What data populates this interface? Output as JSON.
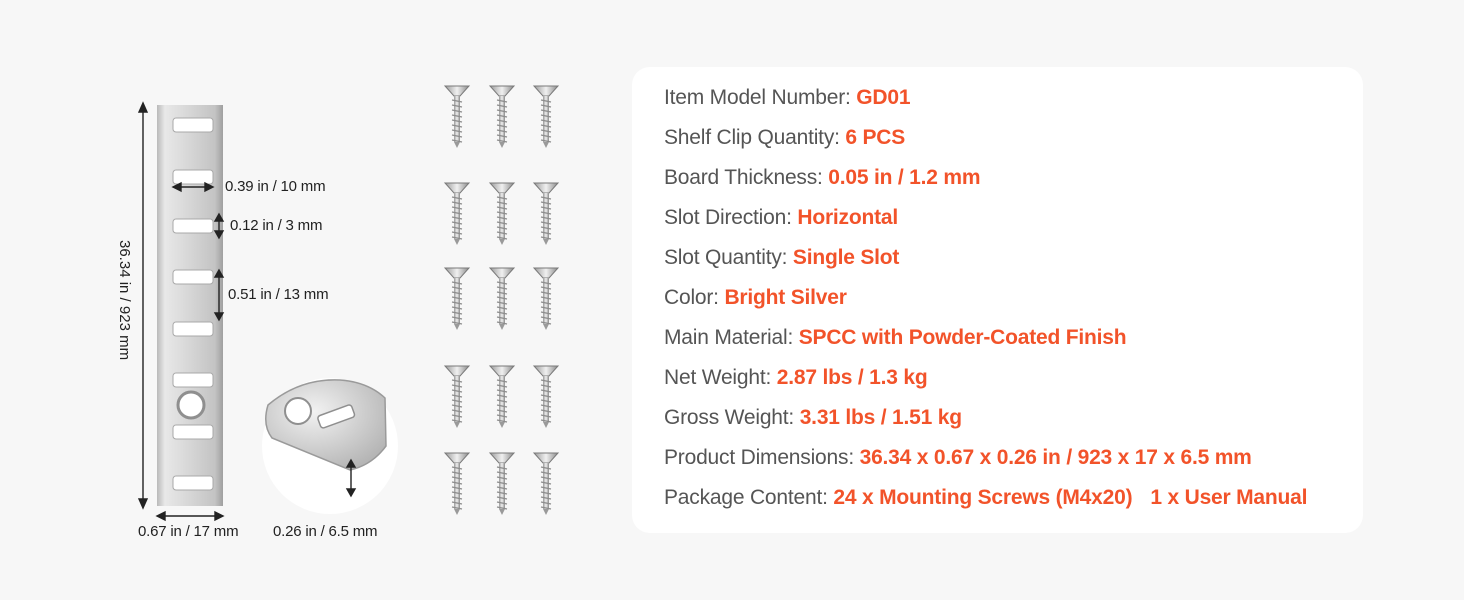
{
  "dimensions": {
    "height": "36.34 in / 923 mm",
    "slot_width": "0.39 in / 10 mm",
    "slot_height": "0.12 in / 3 mm",
    "slot_pitch": "0.51 in / 13 mm",
    "width": "0.67 in / 17 mm",
    "clip_depth": "0.26 in / 6.5 mm"
  },
  "specs": [
    {
      "label": "Item Model Number: ",
      "value": "GD01"
    },
    {
      "label": "Shelf Clip Quantity: ",
      "value": "6 PCS"
    },
    {
      "label": "Board Thickness: ",
      "value": "0.05 in / 1.2 mm"
    },
    {
      "label": "Slot Direction: ",
      "value": "Horizontal"
    },
    {
      "label": "Slot Quantity: ",
      "value": "Single Slot"
    },
    {
      "label": "Color: ",
      "value": "Bright Silver"
    },
    {
      "label": "Main Material: ",
      "value": "SPCC with Powder-Coated Finish"
    },
    {
      "label": "Net Weight: ",
      "value": "2.87 lbs / 1.3 kg"
    },
    {
      "label": "Gross Weight: ",
      "value": "3.31 lbs / 1.51 kg"
    },
    {
      "label": "Product Dimensions: ",
      "value": "36.34 x 0.67 x 0.26 in / 923 x 17 x 6.5 mm"
    },
    {
      "label": "Package Content: ",
      "value": "24 x Mounting Screws (M4x20)",
      "value2": "1 x User Manual"
    }
  ],
  "colors": {
    "accent": "#f2532a",
    "text": "#555555",
    "background": "#f7f7f7",
    "card": "#ffffff"
  }
}
